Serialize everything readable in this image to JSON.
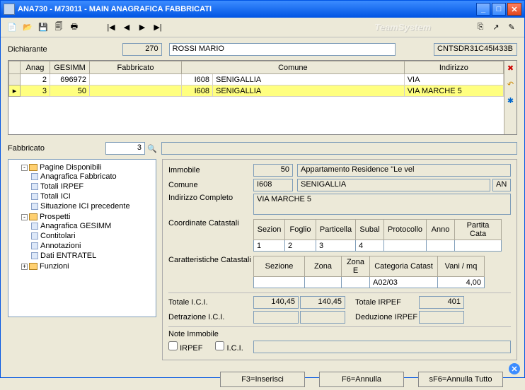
{
  "window": {
    "title": "ANA730  - M73011 -  MAIN ANAGRAFICA FABBRICATI",
    "brand": "TeamSystem"
  },
  "declarant": {
    "label": "Dichiarante",
    "code": "270",
    "name": "ROSSI MARIO",
    "cf": "CNTSDR31C45I433B"
  },
  "grid": {
    "headers": {
      "anag": "Anag",
      "gesimm": "GESIMM",
      "fabbricato": "Fabbricato",
      "comune": "Comune",
      "indirizzo": "Indirizzo"
    },
    "rows": [
      {
        "anag": "2",
        "gesimm": "696972",
        "fabb_code": "I608",
        "comune": "SENIGALLIA",
        "indirizzo": "VIA"
      },
      {
        "anag": "3",
        "gesimm": "50",
        "fabb_code": "I608",
        "comune": "SENIGALLIA",
        "indirizzo": "VIA MARCHE 5",
        "selected": true
      }
    ]
  },
  "fabbricato_field": {
    "label": "Fabbricato",
    "value": "3"
  },
  "tree": {
    "pagine": {
      "label": "Pagine Disponibili",
      "items": [
        "Anagrafica Fabbricato",
        "Totali IRPEF",
        "Totali ICI",
        "Situazione ICI precedente"
      ]
    },
    "prospetti": {
      "label": "Prospetti",
      "items": [
        "Anagrafica GESIMM",
        "Contitolari",
        "Annotazioni",
        "Dati ENTRATEL"
      ]
    },
    "funzioni": {
      "label": "Funzioni"
    }
  },
  "detail": {
    "labels": {
      "immobile": "Immobile",
      "comune": "Comune",
      "indirizzo": "Indirizzo Completo",
      "coord": "Coordinate Catastali",
      "carat": "Caratteristiche Catastali",
      "tot_ici": "Totale I.C.I.",
      "detr_ici": "Detrazione I.C.I.",
      "tot_irpef": "Totale IRPEF",
      "ded_irpef": "Deduzione IRPEF",
      "note": "Note Immobile",
      "irpef_chk": "IRPEF",
      "ici_chk": "I.C.I."
    },
    "immobile_code": "50",
    "immobile_desc": "Appartamento Residence \"Le vel",
    "comune_code": "I608",
    "comune_name": "SENIGALLIA",
    "comune_prov": "AN",
    "indirizzo": "VIA MARCHE 5",
    "coord_headers": {
      "sezione": "Sezion",
      "foglio": "Foglio",
      "particella": "Particella",
      "subal": "Subal",
      "protocollo": "Protocollo",
      "anno": "Anno",
      "partita": "Partita Cata"
    },
    "coord_row": {
      "sezione": "1",
      "foglio": "2",
      "particella": "3",
      "subal": "4",
      "protocollo": "",
      "anno": "",
      "partita": ""
    },
    "carat_headers": {
      "sezione": "Sezione",
      "zona": "Zona",
      "zonae": "Zona E",
      "categoria": "Categoria Catast",
      "vani": "Vani / mq"
    },
    "carat_row": {
      "sezione": "",
      "zona": "",
      "zonae": "",
      "categoria": "A02/03",
      "vani": "4,00"
    },
    "tot_ici_a": "140,45",
    "tot_ici_b": "140,45",
    "detr_ici_a": "",
    "detr_ici_b": "",
    "tot_irpef": "401",
    "ded_irpef": ""
  },
  "footer": {
    "f3": "F3=Inserisci",
    "f6": "F6=Annulla",
    "sf6": "sF6=Annulla Tutto"
  }
}
